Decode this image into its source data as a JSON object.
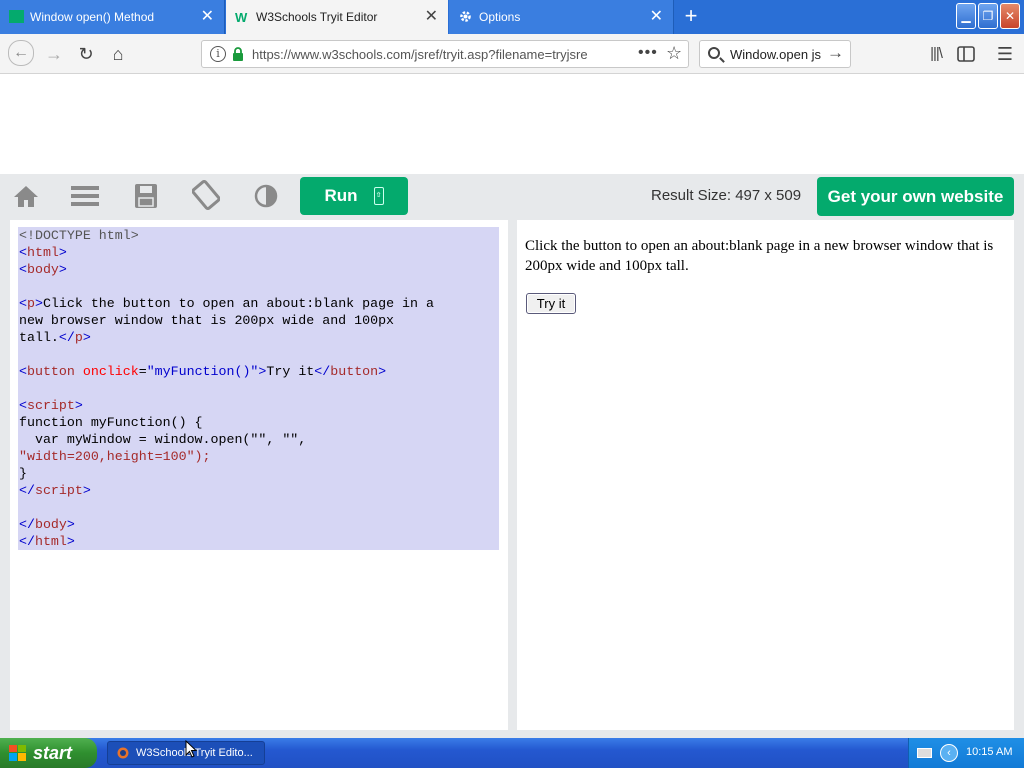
{
  "tabs": [
    {
      "title": "Window open() Method",
      "active": false
    },
    {
      "title": "W3Schools Tryit Editor",
      "active": true
    },
    {
      "title": "Options",
      "active": false
    }
  ],
  "window_controls": {
    "minimize": "▁",
    "maximize": "❐",
    "close": "✕"
  },
  "navbar": {
    "url": "https://www.w3schools.com/jsref/tryit.asp?filename=tryjsre",
    "search_text": "Window.open js",
    "more_label": "•••"
  },
  "toolbar": {
    "run_label": "Run",
    "result_size": "Result Size: 497 x 509",
    "get_website_label": "Get your own website"
  },
  "code": {
    "doctype": "<!DOCTYPE html>",
    "html_open": "html",
    "body_open": "body",
    "p_text_1": "Click the button to open an about:blank page in a",
    "p_text_2": "new browser window that is 200px wide and 100px",
    "p_text_3": "tall.",
    "button_text": "Try it",
    "onclick_value": "\"myFunction()\"",
    "fn_line": "function myFunction() {",
    "var_line": "  var myWindow = window.open(\"\", \"\",",
    "arg_line": "\"width=200,height=100\");",
    "close_brace": "}"
  },
  "result": {
    "text": "Click the button to open an about:blank page in a new browser window that is 200px wide and 100px tall.",
    "button_label": "Try it"
  },
  "taskbar": {
    "start_label": "start",
    "task_item": "W3Schools Tryit Edito...",
    "clock": "10:15 AM"
  },
  "colors": {
    "brand_green": "#04aa6d",
    "title_blue": "#2a6fd6",
    "selection": "#d6d6f4"
  }
}
